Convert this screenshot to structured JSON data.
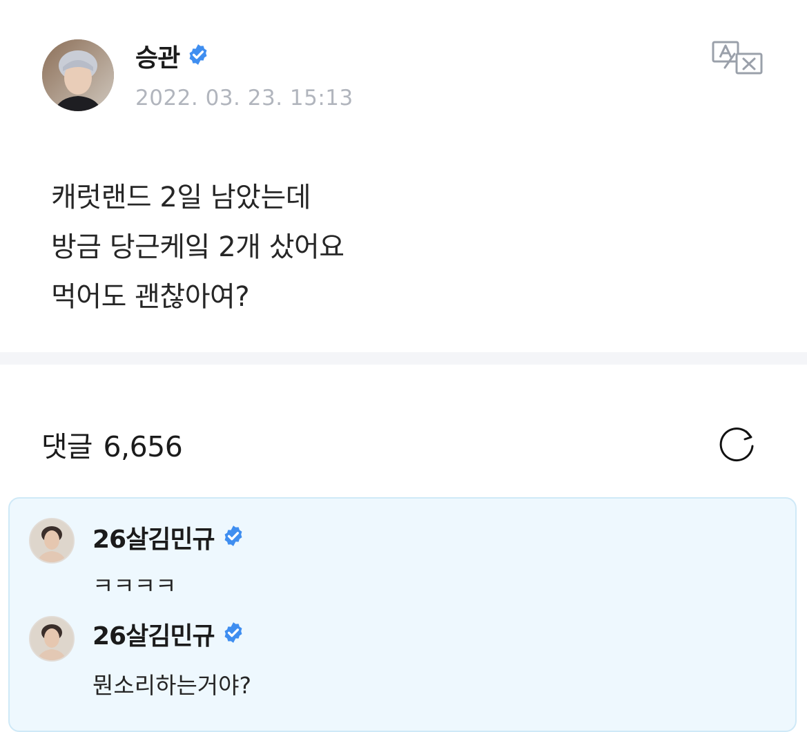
{
  "post": {
    "author": "승관",
    "date": "2022. 03. 23. 15:13",
    "body_lines": [
      "캐럿랜드 2일 남았는데",
      "방금 당근케잌 2개 샀어요",
      "먹어도 괜찮아여?"
    ]
  },
  "icons": {
    "verified": "verified-badge-icon",
    "translate": "translate-icon",
    "refresh": "refresh-icon"
  },
  "comments_section": {
    "label": "댓글",
    "count": "6,656"
  },
  "comments": [
    {
      "author": "26살김민규",
      "text": "ㅋㅋㅋㅋ"
    },
    {
      "author": "26살김민규",
      "text": "뭔소리하는거야?"
    }
  ],
  "colors": {
    "verified_blue": "#3f8ef0",
    "date_gray": "#b1b5bd",
    "comment_bg": "#eef8fe",
    "comment_border": "#cfe9f7",
    "divider": "#f4f5f8"
  }
}
